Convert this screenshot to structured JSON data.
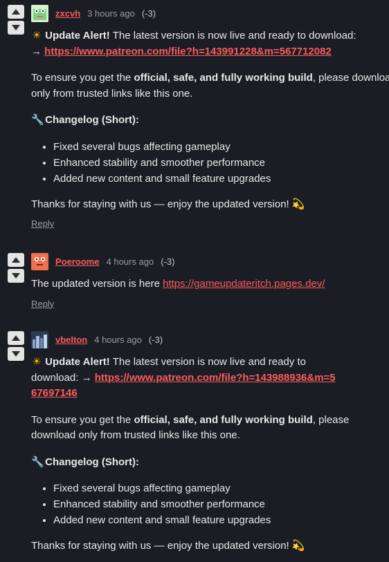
{
  "comments": [
    {
      "author": "zxcvh",
      "time": "3 hours ago",
      "score": "(-3)",
      "alert_icon": "sun-icon",
      "alert_bold": "Update Alert!",
      "alert_text": " The latest version is now live and ready to download:",
      "arrow": "→ ",
      "link": "https://www.patreon.com/file?h=143991228&m=567712082",
      "ensure_pre": "To ensure you get the ",
      "ensure_bold": "official, safe, and fully working build",
      "ensure_post": ", please download only from trusted links like this one.",
      "changelog_icon": "wrench-icon",
      "changelog_title": "Changelog (Short):",
      "items": [
        "Fixed several bugs affecting gameplay",
        "Enhanced stability and smoother performance",
        "Added new content and small feature upgrades"
      ],
      "thanks": "Thanks for staying with us — enjoy the updated version!",
      "thanks_icon": "dizzy-icon",
      "reply": "Reply"
    },
    {
      "author": "Poeroome",
      "time": "4 hours ago",
      "score": "(-3)",
      "text": "The updated version is here ",
      "link": "https://gameupdateritch.pages.dev/",
      "reply": "Reply"
    },
    {
      "author": "vbelton",
      "time": "4 hours ago",
      "score": "(-3)",
      "alert_icon": "sun-icon",
      "alert_bold": "Update Alert!",
      "alert_text": " The latest version is now live and ready to download:",
      "arrow": "→ ",
      "link": "https://www.patreon.com/file?h=143988936&m=567697146",
      "ensure_pre": "To ensure you get the ",
      "ensure_bold": "official, safe, and fully working build",
      "ensure_post": ", please download only from trusted links like this one.",
      "changelog_icon": "wrench-icon",
      "changelog_title": "Changelog (Short):",
      "items": [
        "Fixed several bugs affecting gameplay",
        "Enhanced stability and smoother performance",
        "Added new content and small feature upgrades"
      ],
      "thanks": "Thanks for staying with us — enjoy the updated version!",
      "thanks_icon": "dizzy-icon"
    }
  ],
  "colors": {
    "background": "#1b1d24",
    "link": "#fa5c5c",
    "meta": "#9a9ca3",
    "text": "#e8e8e8"
  }
}
